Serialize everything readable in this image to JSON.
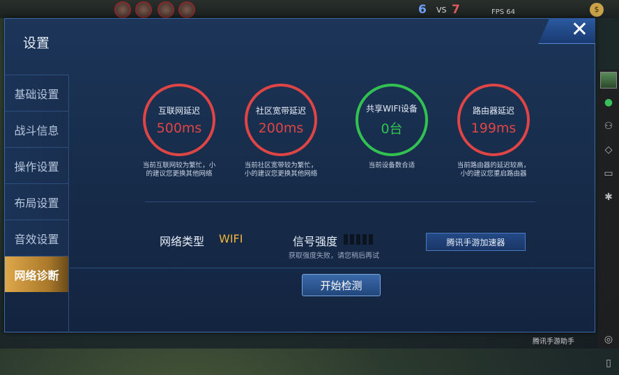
{
  "game": {
    "score_left": "6",
    "vs": "VS",
    "score_right": "7",
    "fps": "FPS 64",
    "coin": "$"
  },
  "settings": {
    "title": "设置",
    "close": "✕",
    "sidebar": [
      {
        "label": "基础设置",
        "active": false
      },
      {
        "label": "战斗信息",
        "active": false
      },
      {
        "label": "操作设置",
        "active": false
      },
      {
        "label": "布局设置",
        "active": false
      },
      {
        "label": "音效设置",
        "active": false
      },
      {
        "label": "网络诊断",
        "active": true
      }
    ],
    "gauges": [
      {
        "label": "互联网延迟",
        "value": "500ms",
        "status": "red",
        "desc1": "当前互联网较为繁忙，小",
        "desc2": "的建议您更换其他网络"
      },
      {
        "label": "社区宽带延迟",
        "value": "200ms",
        "status": "red",
        "desc1": "当前社区宽带较为繁忙，",
        "desc2": "小的建议您更换其他网络"
      },
      {
        "label": "共享WIFI设备",
        "value": "0台",
        "status": "green",
        "desc1": "当前设备数合适",
        "desc2": ""
      },
      {
        "label": "路由器延迟",
        "value": "199ms",
        "status": "red",
        "desc1": "当前路由器的延迟较高，",
        "desc2": "小的建议您重启路由器"
      }
    ],
    "network_type_label": "网络类型",
    "network_type_value": "WIFI",
    "signal_label": "信号强度",
    "signal_note": "获取强度失败，请您稍后再试",
    "accelerator_button": "腾讯手游加速器",
    "start_button": "开始检测"
  },
  "overlay": {
    "watermark": "腾讯手游助手"
  },
  "colors": {
    "alert": "#e04545",
    "ok": "#31c252",
    "highlight": "#f0b43a",
    "active_tab": "#e0a84a"
  }
}
